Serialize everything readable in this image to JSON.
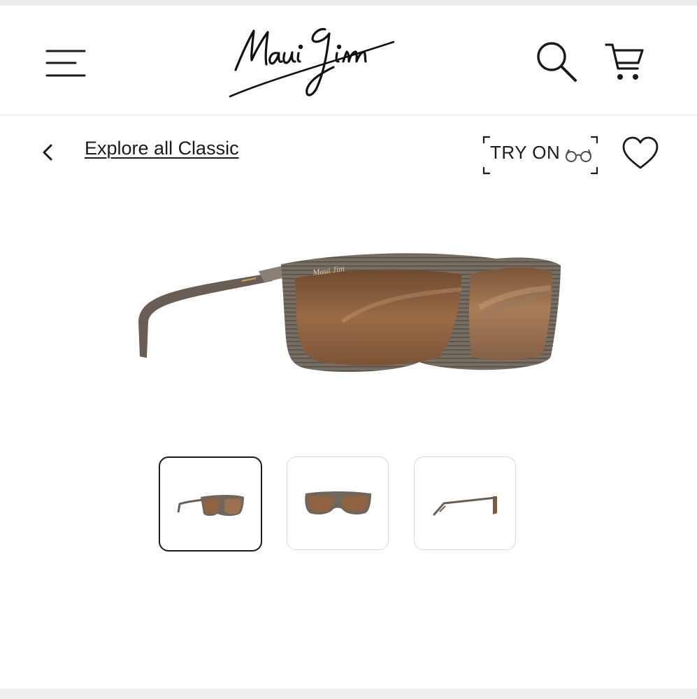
{
  "header": {
    "brand": "Maui Jim",
    "menu_icon": "hamburger-menu-icon",
    "search_icon": "search-icon",
    "cart_icon": "shopping-cart-icon"
  },
  "subnav": {
    "back_icon": "chevron-left-icon",
    "explore_label": "Explore all Classic",
    "try_on_label": "TRY ON",
    "try_on_icon": "glasses-icon",
    "wishlist_icon": "heart-icon"
  },
  "product": {
    "main_image": "sunglasses-three-quarter-view",
    "lens_color": "#8a5a35",
    "frame_color": "#6e6257"
  },
  "thumbnails": [
    {
      "view": "three-quarter",
      "selected": true
    },
    {
      "view": "front",
      "selected": false
    },
    {
      "view": "side",
      "selected": false
    }
  ]
}
